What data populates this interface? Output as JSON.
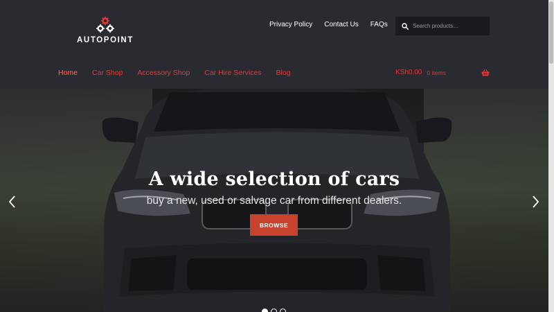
{
  "brand": {
    "name": "AUTOPOINT"
  },
  "top_links": [
    {
      "label": "Privacy Policy"
    },
    {
      "label": "Contact Us"
    },
    {
      "label": "FAQs"
    }
  ],
  "search": {
    "placeholder": "Search products…",
    "value": ""
  },
  "main_nav": [
    {
      "label": "Home",
      "active": true
    },
    {
      "label": "Car Shop",
      "active": false
    },
    {
      "label": "Accessory Shop",
      "active": false
    },
    {
      "label": "Car Hire Services",
      "active": false
    },
    {
      "label": "Blog",
      "active": false
    }
  ],
  "cart": {
    "amount": "KSh0.00",
    "items": "0 items"
  },
  "hero": {
    "title": "A wide selection of cars",
    "subtitle": "buy a new, used or salvage car from different dealers.",
    "button_label": "BROWSE"
  },
  "slider": {
    "total_slides": 3,
    "active_slide": 1
  },
  "icons": {
    "logo": "gears-icon",
    "search": "search-icon",
    "cart": "basket-icon",
    "prev": "chevron-left-icon",
    "next": "chevron-right-icon"
  },
  "colors": {
    "header_bg": "#2a2b31",
    "accent": "#e6373a",
    "button": "#c8432e",
    "active_nav": "#ff6b5e"
  }
}
